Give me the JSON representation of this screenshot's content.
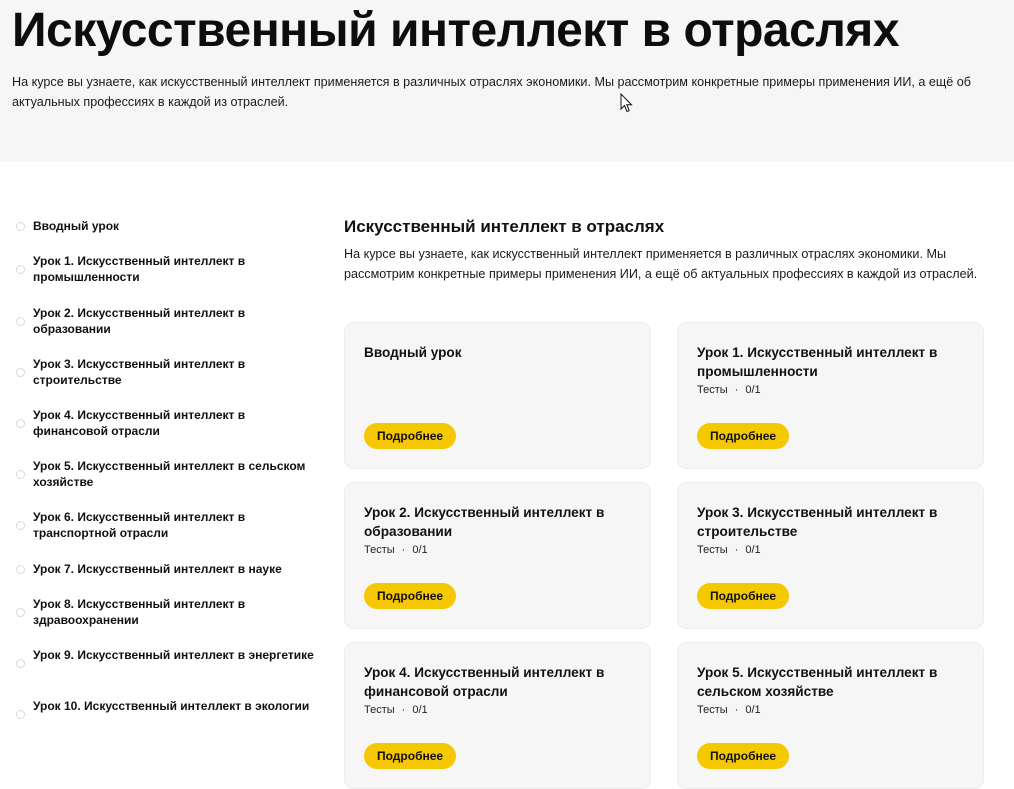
{
  "hero": {
    "title": "Искусственный интеллект в отраслях",
    "description": "На курсе вы узнаете, как искусственный интеллект применяется в различных отраслях экономики. Мы рассмотрим конкретные примеры применения ИИ, а ещё об актуальных профессиях в каждой из отраслей."
  },
  "sidebar": {
    "items": [
      {
        "label": "Вводный урок"
      },
      {
        "label": "Урок 1. Искусственный интеллект в промышленности"
      },
      {
        "label": "Урок 2. Искусственный интеллект в образовании"
      },
      {
        "label": "Урок 3. Искусственный интеллект в строительстве"
      },
      {
        "label": "Урок 4. Искусственный интеллект в финансовой отрасли"
      },
      {
        "label": "Урок 5. Искусственный интеллект в сельском хозяйстве"
      },
      {
        "label": "Урок 6. Искусственный интеллект в транспортной отрасли"
      },
      {
        "label": "Урок 7. Искусственный интеллект в науке"
      },
      {
        "label": "Урок 8. Искусственный интеллект в здравоохранении"
      },
      {
        "label": "Урок 9. Искусственный интеллект в энергетике"
      },
      {
        "label": "Урок 10. Искусственный интеллект в экологии"
      }
    ]
  },
  "main": {
    "title": "Искусственный интеллект в отраслях",
    "description": "На курсе вы узнаете, как искусственный интеллект применяется в различных отраслях экономики. Мы рассмотрим конкретные примеры применения ИИ, а ещё об актуальных профессиях в каждой из отраслей."
  },
  "cards": [
    {
      "title": "Вводный урок",
      "tests_label": "",
      "tests_value": "",
      "button": "Подробнее"
    },
    {
      "title": "Урок 1. Искусственный интеллект в промышленности",
      "tests_label": "Тесты",
      "tests_value": "0/1",
      "button": "Подробнее"
    },
    {
      "title": "Урок 2. Искусственный интеллект в образовании",
      "tests_label": "Тесты",
      "tests_value": "0/1",
      "button": "Подробнее"
    },
    {
      "title": "Урок 3. Искусственный интеллект в строительстве",
      "tests_label": "Тесты",
      "tests_value": "0/1",
      "button": "Подробнее"
    },
    {
      "title": "Урок 4. Искусственный интеллект в финансовой отрасли",
      "tests_label": "Тесты",
      "tests_value": "0/1",
      "button": "Подробнее"
    },
    {
      "title": "Урок 5. Искусственный интеллект в сельском хозяйстве",
      "tests_label": "Тесты",
      "tests_value": "0/1",
      "button": "Подробнее"
    }
  ],
  "meta_separator": "·",
  "colors": {
    "accent": "#f5c800",
    "card_bg": "#f6f6f6",
    "hero_bg": "#f6f6f6"
  }
}
